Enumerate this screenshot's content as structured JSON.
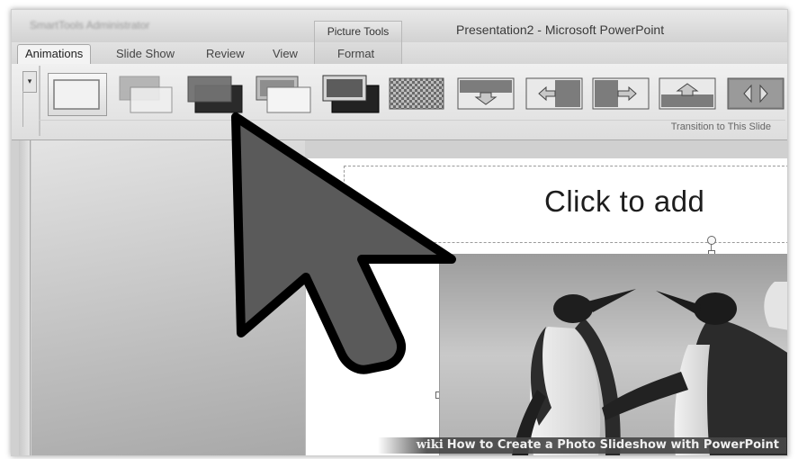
{
  "window": {
    "title": "Presentation2 - Microsoft PowerPoint",
    "context_tab_group": "Picture Tools",
    "qat_blurred": "SmartTools Administrator"
  },
  "tabs": [
    {
      "label": "Animations",
      "active": true
    },
    {
      "label": "Slide Show",
      "active": false
    },
    {
      "label": "Review",
      "active": false
    },
    {
      "label": "View",
      "active": false
    },
    {
      "label": "Format",
      "active": false
    }
  ],
  "ribbon": {
    "group_label": "Transition to This Slide",
    "gallery_scroll_glyph": "▾",
    "transitions": [
      "no-transition",
      "fade-smoothly",
      "fade-through-black",
      "cut",
      "cut-through-black",
      "dissolve",
      "wipe-down",
      "wipe-left",
      "wipe-right",
      "wipe-up",
      "split"
    ]
  },
  "slide": {
    "title_placeholder": "Click to add"
  },
  "cursor": {
    "icon": "mouse-pointer-arrow-icon"
  },
  "watermark": {
    "brand": "wiki",
    "text": "How to Create a Photo Slideshow with PowerPoint"
  },
  "colors": {
    "ribbon_bg": "#e6e6e6",
    "cursor_fill": "#5a5a5a",
    "cursor_outline": "#000000",
    "slide_bg": "#ffffff"
  }
}
